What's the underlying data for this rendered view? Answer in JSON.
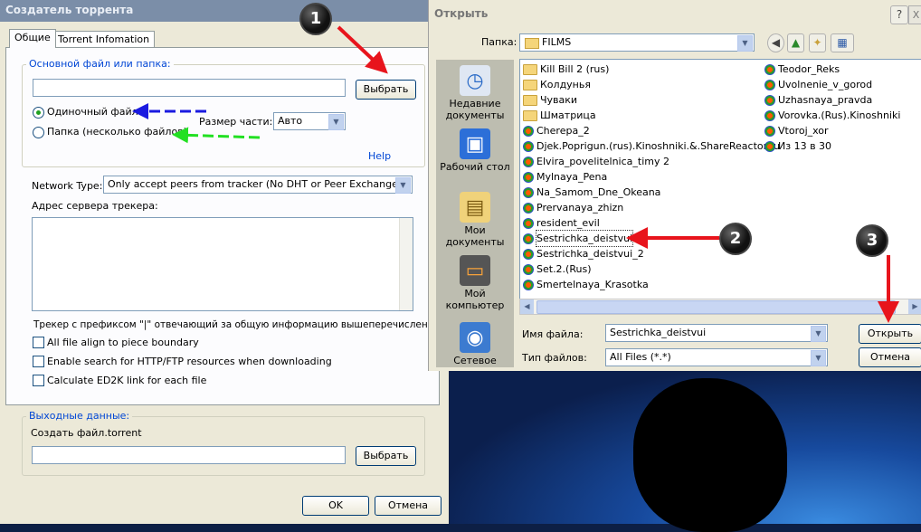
{
  "creator": {
    "title": "Создатель торрента",
    "tabs": [
      "Общие",
      "Torrent Infomation"
    ],
    "source_group": "Основной файл или папка:",
    "browse_label": "Выбрать",
    "single_file_label": "Одиночный файл",
    "folder_label": "Папка (несколько файлов)",
    "piece_size_label": "Размер части:",
    "piece_size_value": "Авто",
    "help_link": "Help",
    "network_type_label": "Network Type:",
    "network_type_value": "Only accept peers from tracker (No DHT or Peer Exchange)",
    "tracker_label": "Адрес сервера трекера:",
    "tracker_prefix_note": "Трекер с префиксом \"|\" отвечающий за общую информацию вышеперечисленных",
    "options": [
      "All file align to piece boundary",
      "Enable search for HTTP/FTP resources when downloading",
      "Calculate ED2K link for each file"
    ],
    "output_group": "Выходные данные:",
    "output_label": "Создать файл.torrent",
    "output_browse_label": "Выбрать",
    "ok_label": "OK",
    "cancel_label": "Отмена"
  },
  "open_dialog": {
    "title": "Открыть",
    "help_btn": "?",
    "close_btn": "X",
    "folder_label": "Папка:",
    "folder_value": "FILMS",
    "places": [
      "Недавние документы",
      "Рабочий стол",
      "Мои документы",
      "Мой компьютер",
      "Сетевое"
    ],
    "files_col1": [
      {
        "name": "Kill Bill 2 (rus)",
        "type": "folder"
      },
      {
        "name": "Колдунья",
        "type": "folder"
      },
      {
        "name": "Чуваки",
        "type": "folder"
      },
      {
        "name": "Шматрица",
        "type": "folder"
      },
      {
        "name": "Cherepa_2",
        "type": "media"
      },
      {
        "name": "Djek.Poprigun.(rus).Kinoshniki.&.ShareReactor.ru",
        "type": "media"
      },
      {
        "name": "Elvira_povelitelnica_timy 2",
        "type": "media"
      },
      {
        "name": "Mylnaya_Pena",
        "type": "media"
      },
      {
        "name": "Na_Samom_Dne_Okeana",
        "type": "media"
      },
      {
        "name": "Prervanaya_zhizn",
        "type": "media"
      },
      {
        "name": "resident_evil",
        "type": "media"
      },
      {
        "name": "Sestrichka_deistvui",
        "type": "media",
        "selected": true
      },
      {
        "name": "Sestrichka_deistvui_2",
        "type": "media"
      },
      {
        "name": "Set.2.(Rus)",
        "type": "media"
      },
      {
        "name": "Smertelnaya_Krasotka",
        "type": "media"
      }
    ],
    "files_col2": [
      {
        "name": "Teodor_Reks",
        "type": "media"
      },
      {
        "name": "Uvolnenie_v_gorod",
        "type": "media"
      },
      {
        "name": "Uzhasnaya_pravda",
        "type": "media"
      },
      {
        "name": "Vorovka.(Rus).Kinoshniki",
        "type": "media"
      },
      {
        "name": "Vtoroj_xor",
        "type": "media"
      },
      {
        "name": "Из 13 в 30",
        "type": "media"
      }
    ],
    "filename_label": "Имя файла:",
    "filename_value": "Sestrichka_deistvui",
    "filetype_label": "Тип файлов:",
    "filetype_value": "All Files (*.*)",
    "open_label": "Открыть",
    "cancel_label": "Отмена"
  },
  "markers": [
    "1",
    "2",
    "3"
  ],
  "colors": {
    "arrow_red": "#e8141c",
    "arrow_blue": "#1a1ae0",
    "arrow_green": "#22e022",
    "link_blue": "#0046d5"
  }
}
